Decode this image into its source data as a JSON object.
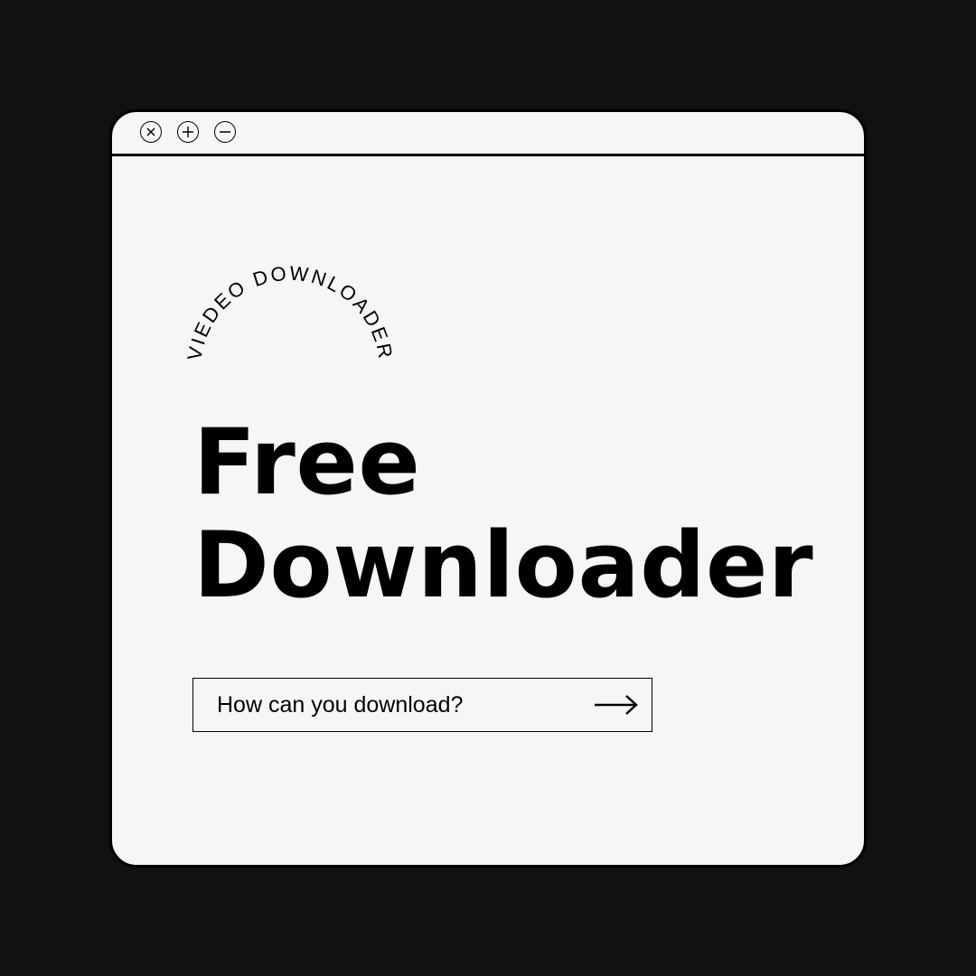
{
  "window": {
    "controls": [
      {
        "name": "close-icon"
      },
      {
        "name": "plus-icon"
      },
      {
        "name": "minus-icon"
      }
    ]
  },
  "curved_label": "VIEDEO DOWNLOADER",
  "headline": {
    "line1": "Free",
    "line2": "Downloader"
  },
  "cta": {
    "label": "How can you download?",
    "icon": "arrow-right-icon"
  },
  "colors": {
    "background": "#111111",
    "window": "#f5f7f6",
    "ink": "#000000"
  }
}
